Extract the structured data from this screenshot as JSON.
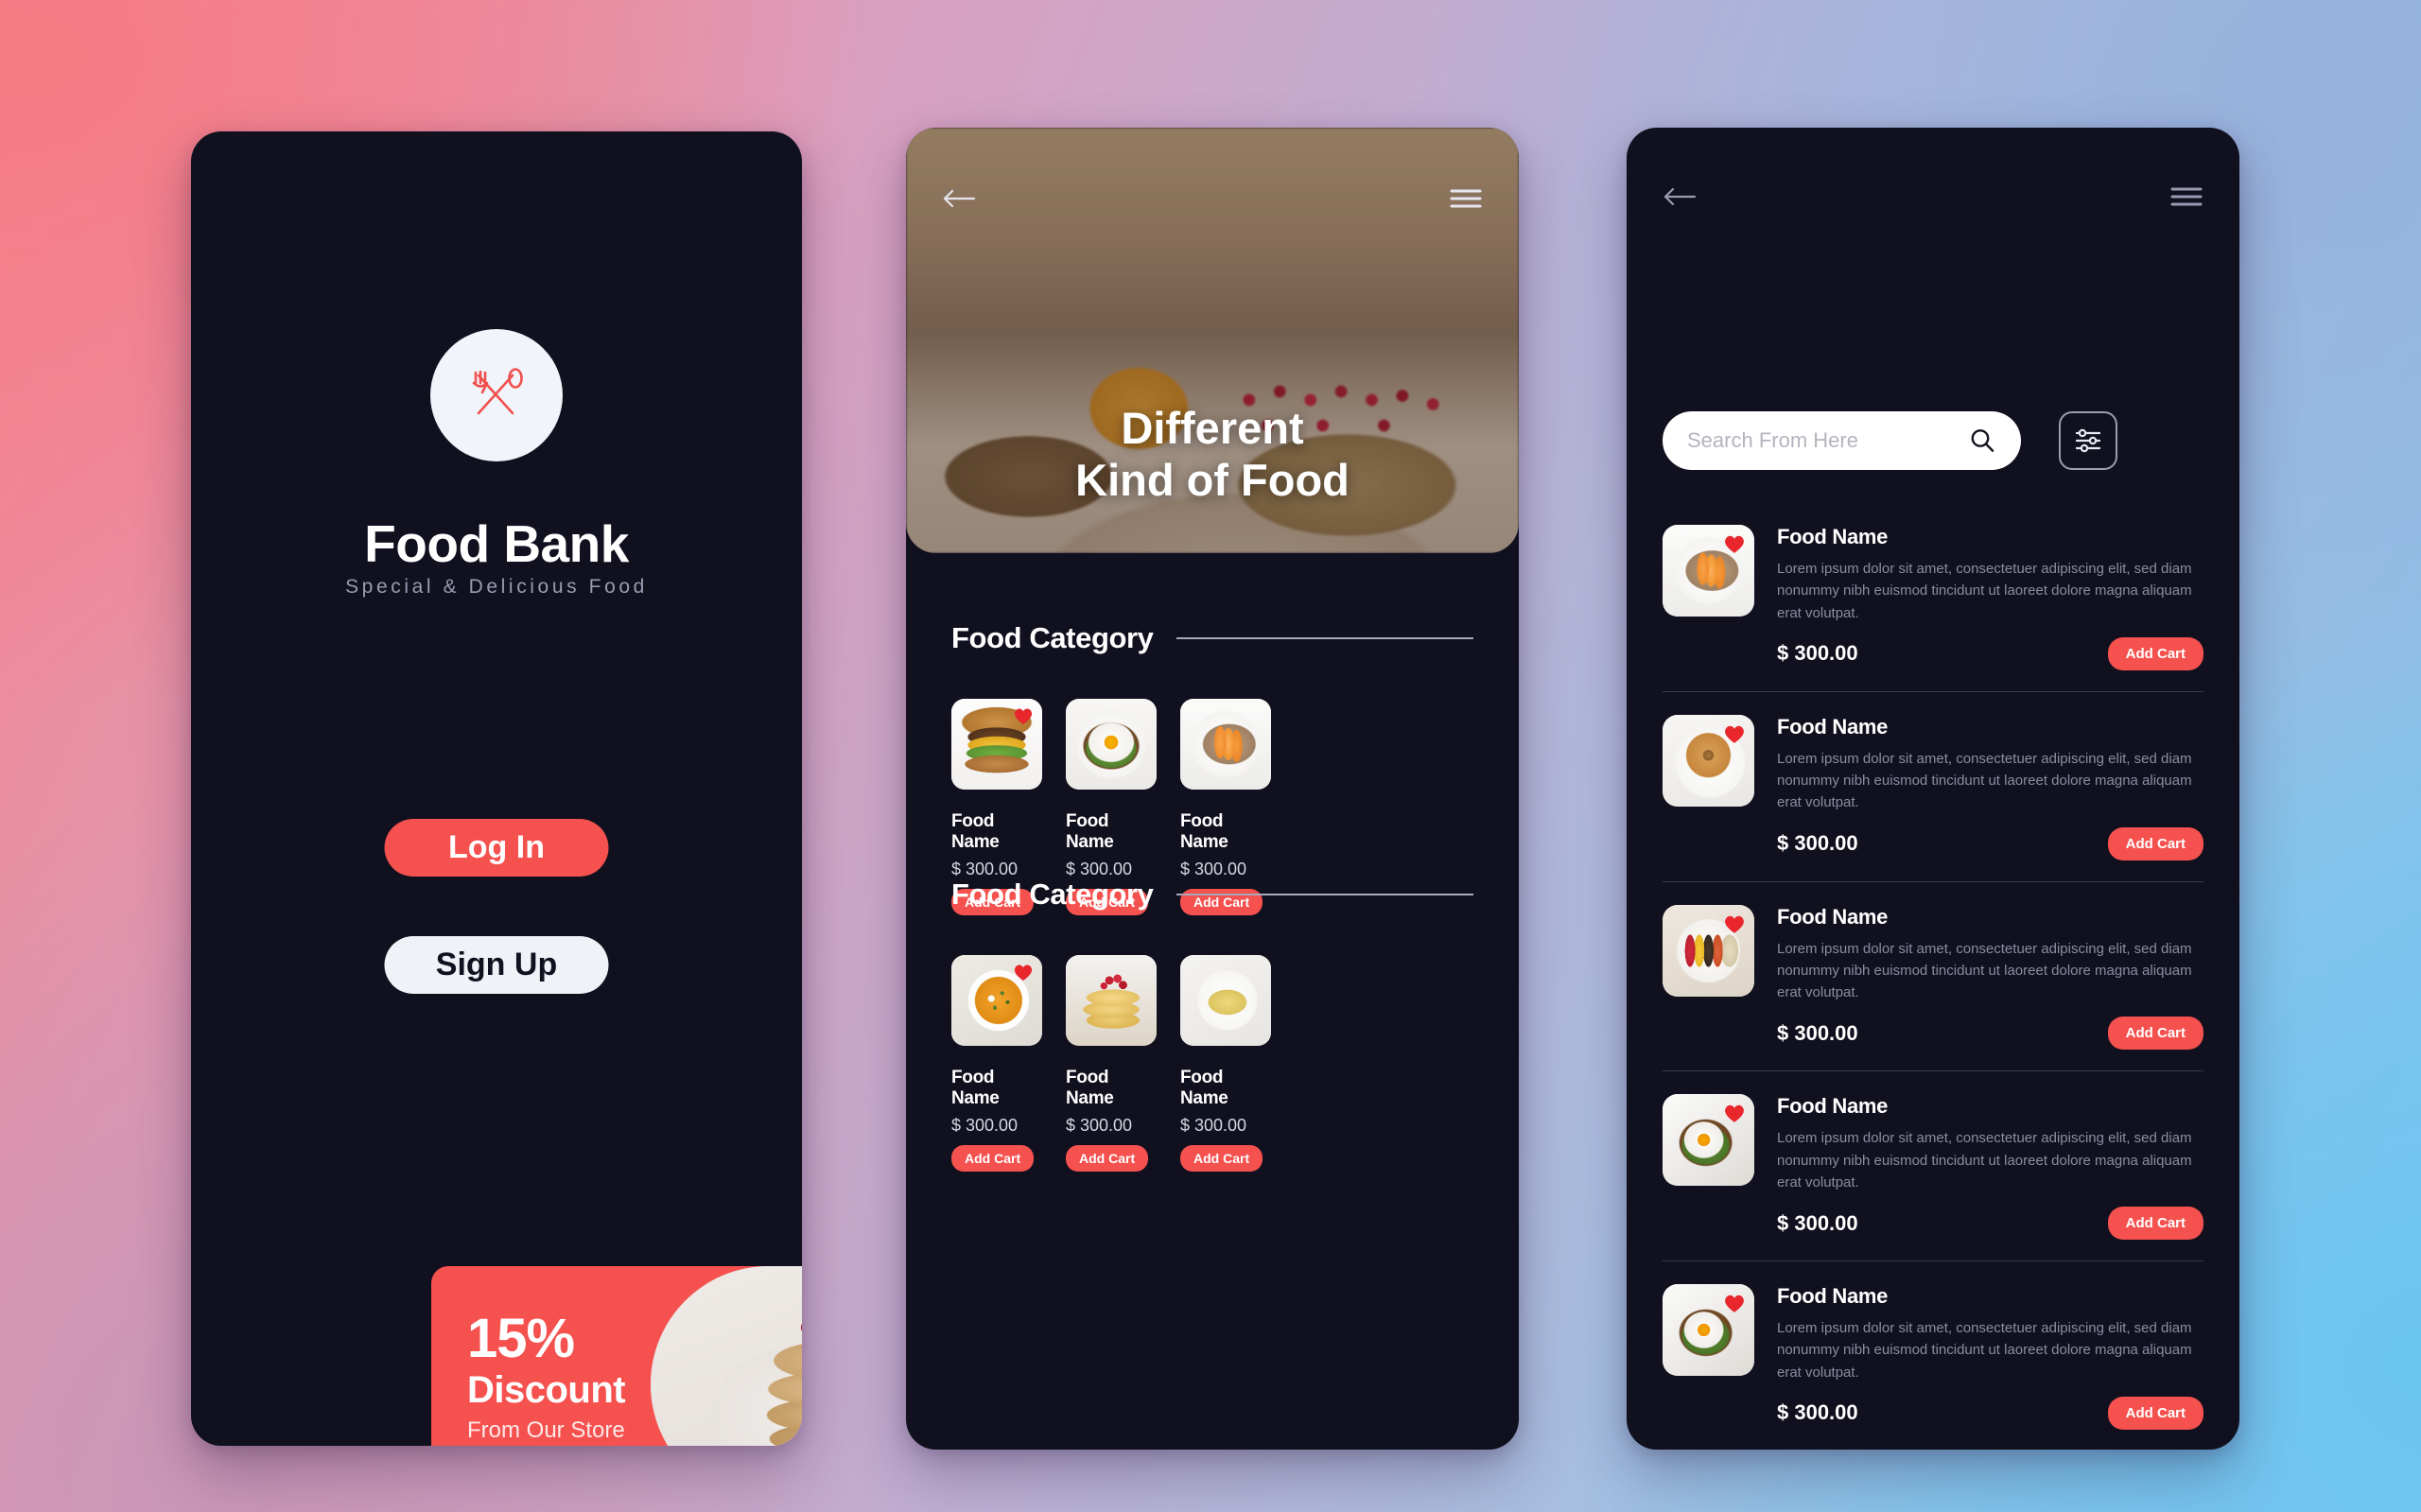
{
  "brand": {
    "logo_icon": "fork-spoon-icon",
    "title": "Food Bank",
    "tagline": "Special & Delicious Food"
  },
  "auth": {
    "login_label": "Log In",
    "signup_label": "Sign Up"
  },
  "discount": {
    "percent": "15%",
    "word": "Discount",
    "from": "From Our Store"
  },
  "hero": {
    "title_line1": "Different",
    "title_line2": "Kind of Food",
    "back_icon": "back-arrow-icon",
    "menu_icon": "hamburger-menu-icon"
  },
  "sections": [
    {
      "title": "Food Category",
      "cards": [
        {
          "name": "Food Name",
          "price": "$ 300.00",
          "cta": "Add Cart",
          "image": "burger",
          "favorite": true
        },
        {
          "name": "Food Name",
          "price": "$ 300.00",
          "cta": "Add Cart",
          "image": "egg-toast",
          "favorite": false
        },
        {
          "name": "Food Name",
          "price": "$ 300.00",
          "cta": "Add Cart",
          "image": "peach-granola",
          "favorite": false
        }
      ]
    },
    {
      "title": "Food Category",
      "cards": [
        {
          "name": "Food Name",
          "price": "$ 300.00",
          "cta": "Add Cart",
          "image": "pumpkin-soup",
          "favorite": true
        },
        {
          "name": "Food Name",
          "price": "$ 300.00",
          "cta": "Add Cart",
          "image": "berry-waffle",
          "favorite": false
        },
        {
          "name": "Food Name",
          "price": "$ 300.00",
          "cta": "Add Cart",
          "image": "pasta",
          "favorite": false
        }
      ]
    }
  ],
  "search": {
    "placeholder": "Search From Here",
    "value": "",
    "search_icon": "search-icon",
    "filter_icon": "filter-sliders-icon",
    "back_icon": "back-arrow-icon",
    "menu_icon": "hamburger-menu-icon"
  },
  "list": {
    "description": "Lorem ipsum dolor sit amet, consectetuer adipiscing elit, sed diam nonummy nibh euismod tincidunt ut laoreet dolore magna aliquam erat volutpat.",
    "items": [
      {
        "name": "Food Name",
        "price": "$ 300.00",
        "cta": "Add Cart",
        "image": "peach-granola",
        "favorite": true
      },
      {
        "name": "Food Name",
        "price": "$ 300.00",
        "cta": "Add Cart",
        "image": "bagel",
        "favorite": true
      },
      {
        "name": "Food Name",
        "price": "$ 300.00",
        "cta": "Add Cart",
        "image": "fruit-bowl",
        "favorite": true
      },
      {
        "name": "Food Name",
        "price": "$ 300.00",
        "cta": "Add Cart",
        "image": "egg-toast-box",
        "favorite": true
      },
      {
        "name": "Food Name",
        "price": "$ 300.00",
        "cta": "Add Cart",
        "image": "egg-toast-box",
        "favorite": true
      }
    ]
  },
  "colors": {
    "accent": "#f5514e",
    "heart": "#e8262b",
    "phone_bg": "#10101f",
    "text_primary": "#ffffff",
    "text_muted": "#8c8ca2"
  }
}
